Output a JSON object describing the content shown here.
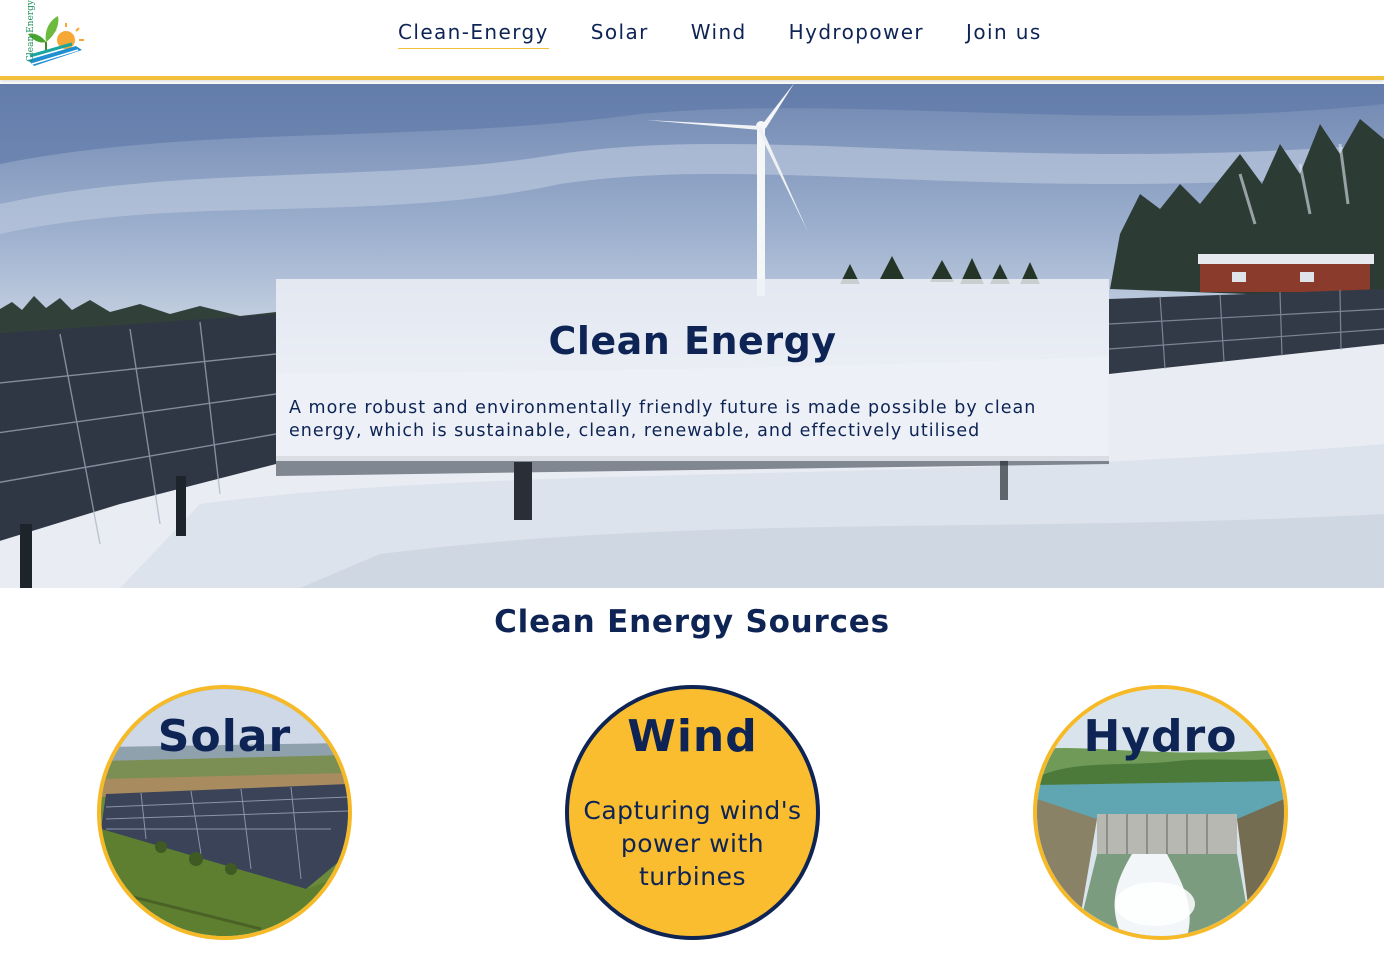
{
  "brand": {
    "logo_text": "Clean Energy"
  },
  "nav": {
    "items": [
      {
        "label": "Clean-Energy",
        "active": true
      },
      {
        "label": "Solar",
        "active": false
      },
      {
        "label": "Wind",
        "active": false
      },
      {
        "label": "Hydropower",
        "active": false
      },
      {
        "label": "Join us",
        "active": false
      }
    ]
  },
  "hero": {
    "title": "Clean Energy",
    "text": "A more robust and environmentally friendly future is made possible by clean energy, which is sustainable, clean, renewable, and effectively utilised"
  },
  "sources": {
    "title": "Clean Energy Sources",
    "cards": [
      {
        "title": "Solar",
        "description": ""
      },
      {
        "title": "Wind",
        "description": "Capturing wind's power with turbines"
      },
      {
        "title": "Hydro",
        "description": ""
      }
    ]
  },
  "colors": {
    "navy": "#0d2455",
    "accent": "#f3c03b",
    "wind_card": "#f9bd2f"
  }
}
